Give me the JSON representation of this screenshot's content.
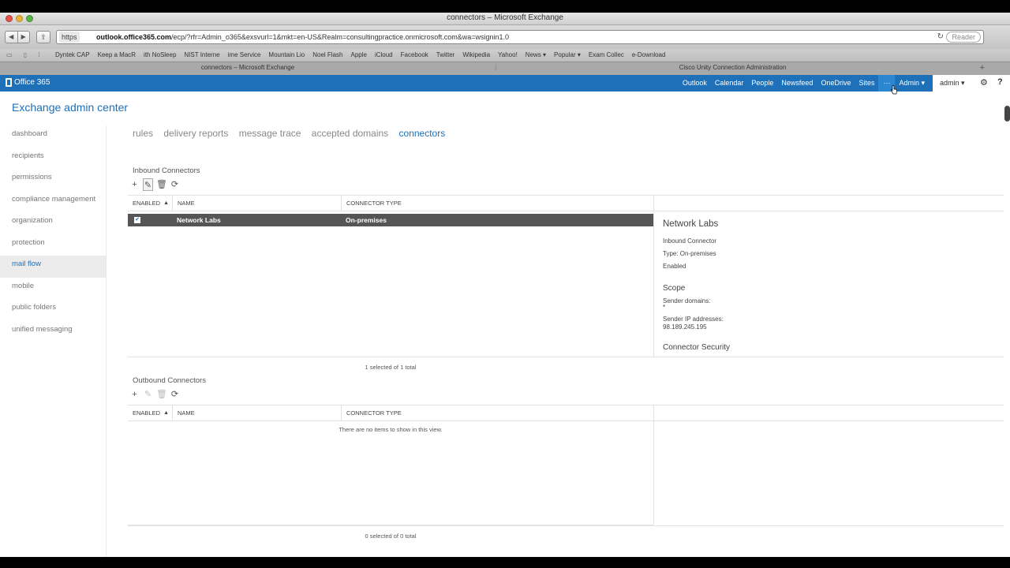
{
  "window": {
    "title": "connectors – Microsoft Exchange"
  },
  "browser": {
    "nav_back": "◀",
    "nav_forward": "▶",
    "share": "⇪",
    "scheme": "https",
    "url_host": "outlook.office365.com",
    "url_path": "/ecp/?rfr=Admin_o365&exsvurl=1&mkt=en-US&Realm=consultingpractice.onmicrosoft.com&wa=wsignin1.0",
    "reload": "↻",
    "reader": "Reader",
    "bookmarks_icons": "▭ ▯ ⁞",
    "bookmarks": [
      "Dyntek CAP",
      "Keep a MacR",
      "ith NoSleep",
      "NIST Interne",
      "ime Service",
      "Mountain Lio",
      "Noel Flash",
      "Apple",
      "iCloud",
      "Facebook",
      "Twitter",
      "Wikipedia",
      "Yahoo!",
      "News ▾",
      "Popular ▾",
      "Exam Collec",
      "e-Download"
    ],
    "tabs": [
      "connectors – Microsoft Exchange",
      "Cisco Unity Connection Administration"
    ],
    "tab_plus": "+"
  },
  "o365": {
    "brand": "Office 365",
    "nav": [
      "Outlook",
      "Calendar",
      "People",
      "Newsfeed",
      "OneDrive",
      "Sites"
    ],
    "more": "···",
    "admin_menu": "Admin ▾",
    "user": "admin ▾",
    "gear": "⚙",
    "help": "?"
  },
  "eac": {
    "title": "Exchange admin center",
    "sidenav": [
      "dashboard",
      "recipients",
      "permissions",
      "compliance management",
      "organization",
      "protection",
      "mail flow",
      "mobile",
      "public folders",
      "unified messaging"
    ],
    "active_sidenav": "mail flow",
    "tabs": [
      "rules",
      "delivery reports",
      "message trace",
      "accepted domains",
      "connectors"
    ],
    "active_tab": "connectors"
  },
  "inbound": {
    "label": "Inbound Connectors",
    "actions": {
      "add": "+",
      "edit": "✎",
      "delete": "🗑",
      "refresh": "⟳"
    },
    "columns": [
      "ENABLED",
      "NAME",
      "CONNECTOR TYPE"
    ],
    "sort_arrow": "▲",
    "rows": [
      {
        "enabled": "✔",
        "name": "Network Labs",
        "type": "On-premises"
      }
    ],
    "count": "1 selected of 1 total"
  },
  "details": {
    "title": "Network Labs",
    "line1": "Inbound Connector",
    "line2": "Type: On-premises",
    "line3": "Enabled",
    "scope_heading": "Scope",
    "sender_domains_label": "Sender domains:",
    "sender_domains_value": "*",
    "sender_ip_label": "Sender IP addresses:",
    "sender_ip_value": "98.189.245.195",
    "security_heading": "Connector Security"
  },
  "outbound": {
    "label": "Outbound Connectors",
    "actions": {
      "add": "+",
      "edit": "✎",
      "delete": "🗑",
      "refresh": "⟳"
    },
    "columns": [
      "ENABLED",
      "NAME",
      "CONNECTOR TYPE"
    ],
    "sort_arrow": "▲",
    "empty": "There are no items to show in this view.",
    "count": "0 selected of 0 total"
  }
}
